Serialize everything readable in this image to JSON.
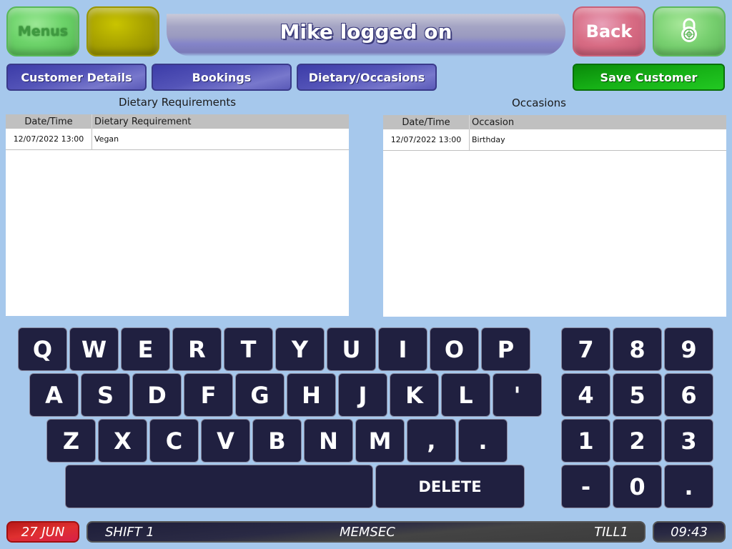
{
  "header": {
    "menus_label": "Menus",
    "title": "Mike logged on",
    "back_label": "Back",
    "lock_icon": "padlock-icon"
  },
  "tabs": [
    {
      "label": "Customer Details"
    },
    {
      "label": "Bookings"
    },
    {
      "label": "Dietary/Occasions"
    }
  ],
  "save_label": "Save Customer",
  "dietary": {
    "title": "Dietary Requirements",
    "columns": [
      "Date/Time",
      "Dietary Requirement"
    ],
    "rows": [
      {
        "datetime": "12/07/2022 13:00",
        "value": "Vegan"
      }
    ]
  },
  "occasions": {
    "title": "Occasions",
    "columns": [
      "Date/Time",
      "Occasion"
    ],
    "rows": [
      {
        "datetime": "12/07/2022 13:00",
        "value": "Birthday"
      }
    ]
  },
  "keyboard": {
    "row1": [
      "Q",
      "W",
      "E",
      "R",
      "T",
      "Y",
      "U",
      "I",
      "O",
      "P"
    ],
    "row2": [
      "A",
      "S",
      "D",
      "F",
      "G",
      "H",
      "J",
      "K",
      "L",
      "'"
    ],
    "row3": [
      "Z",
      "X",
      "C",
      "V",
      "B",
      "N",
      "M",
      ",",
      "."
    ],
    "space_label": "",
    "delete_label": "DELETE"
  },
  "numpad": {
    "keys": [
      "7",
      "8",
      "9",
      "4",
      "5",
      "6",
      "1",
      "2",
      "3",
      "-",
      "0",
      "."
    ]
  },
  "status": {
    "date": "27 JUN",
    "shift": "SHIFT 1",
    "user": "MEMSEC",
    "till": "TILL1",
    "time": "09:43"
  }
}
